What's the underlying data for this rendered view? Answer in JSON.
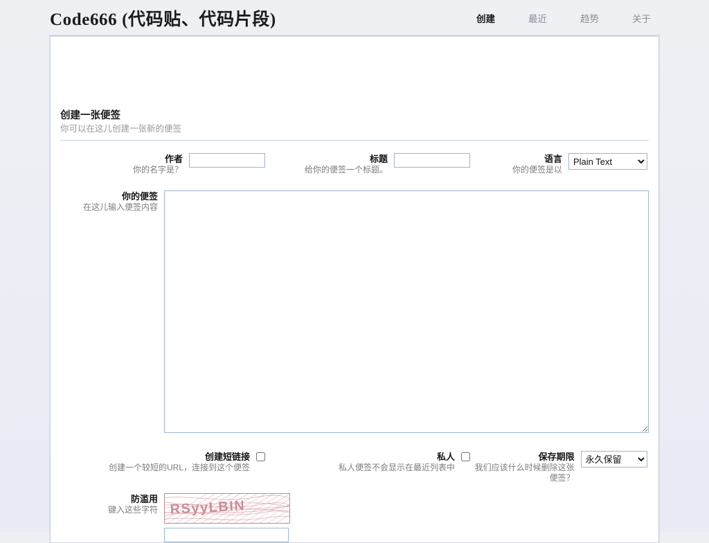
{
  "header": {
    "brand": "Code666 (代码贴、代码片段)",
    "nav": [
      {
        "label": "创建",
        "active": true
      },
      {
        "label": "最近",
        "active": false
      },
      {
        "label": "趋势",
        "active": false
      },
      {
        "label": "关于",
        "active": false
      }
    ]
  },
  "page": {
    "title": "创建一张便签",
    "subtitle": "你可以在这儿创建一张新的便签"
  },
  "form": {
    "author": {
      "label": "作者",
      "hint": "你的名字是？",
      "value": "",
      "placeholder": ""
    },
    "title": {
      "label": "标题",
      "hint": "给你的便签一个标题。",
      "value": "",
      "placeholder": ""
    },
    "language": {
      "label": "语言",
      "hint": "你的便签是以",
      "selected": "Plain Text",
      "options": [
        "Plain Text"
      ]
    },
    "content": {
      "label": "你的便签",
      "hint": "在这儿输入便签内容",
      "value": "",
      "placeholder": ""
    },
    "shortlink": {
      "label": "创建短链接",
      "hint": "创建一个较短的URL，连接到这个便签",
      "checked": false
    },
    "private": {
      "label": "私人",
      "hint": "私人便签不会显示在最近列表中",
      "checked": false
    },
    "expire": {
      "label": "保存期限",
      "hint": "我们应该什么时候删除这张便签？",
      "selected": "永久保留",
      "options": [
        "永久保留"
      ]
    },
    "captcha": {
      "label": "防滥用",
      "hint": "键入这些字符",
      "image_text": "RSyyLBIN",
      "value": "",
      "placeholder": ""
    }
  },
  "colors": {
    "page_bg": "#ebeef4",
    "panel_bg": "#ffffff",
    "panel_border": "#ccd3e0",
    "input_border": "#9cb5d2",
    "label": "#161616",
    "hint": "#7d7d7d",
    "nav_inactive": "#8b8f98",
    "nav_active": "#1e1e1e",
    "captcha_ink": "#c98d95"
  }
}
